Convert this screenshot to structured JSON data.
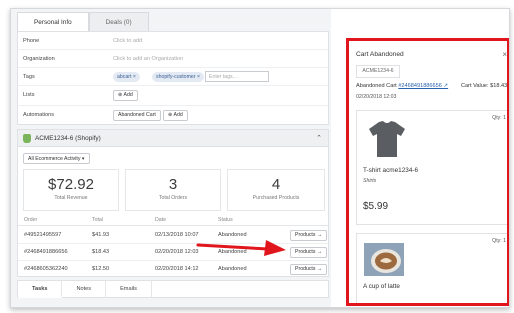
{
  "tabs": [
    {
      "label": "Personal Info",
      "active": true
    },
    {
      "label": "Deals (0)",
      "active": false
    }
  ],
  "info": {
    "phone": {
      "label": "Phone",
      "value": "Click to add"
    },
    "organization": {
      "label": "Organization",
      "value": "Click to add an Organization"
    },
    "tags": {
      "label": "Tags",
      "chips": [
        "abcart",
        "shopify-customer"
      ],
      "placeholder": "Enter tags..."
    },
    "lists": {
      "label": "Lists",
      "button": "Add"
    },
    "automations": {
      "label": "Automations",
      "chip": "Abandoned Cart",
      "button": "Add"
    }
  },
  "shop": {
    "title": "ACME1234-6 (Shopify)",
    "dropdown": "All Ecommerce Activity",
    "stats": [
      {
        "value": "$72.92",
        "label": "Total Revenue"
      },
      {
        "value": "3",
        "label": "Total Orders"
      },
      {
        "value": "4",
        "label": "Purchased Products"
      }
    ],
    "columns": [
      "Order",
      "Total",
      "Date",
      "Status"
    ],
    "rows": [
      {
        "order": "#49521495597",
        "total": "$41.93",
        "date": "02/13/2018 10:07",
        "status": "Abandoned",
        "button": "Products"
      },
      {
        "order": "#2468491886656",
        "total": "$18.43",
        "date": "02/20/2018 12:03",
        "status": "Abandoned",
        "button": "Products"
      },
      {
        "order": "#2468605362240",
        "total": "$12.50",
        "date": "02/20/2018 14:12",
        "status": "Abandoned",
        "button": "Products"
      }
    ]
  },
  "bottom_tabs": [
    "Tasks",
    "Notes",
    "Emails"
  ],
  "panel": {
    "title": "Cart Abandoned",
    "close": "×",
    "tab": "ACME1234-6",
    "cart_label": "Abandoned Cart",
    "cart_link": "#2468491886656 ↗",
    "value_label": "Cart Value: $18.43",
    "date": "02/20/2018 12:03",
    "items": [
      {
        "qty": "Qty: 1",
        "name": "T-shirt acme1234-6",
        "category": "Shirts",
        "price": "$5.99"
      },
      {
        "qty": "Qty: 1",
        "name": "A cup of latte",
        "category": "",
        "price": ""
      }
    ]
  },
  "colors": {
    "highlight": "#e0161c",
    "link": "#2a62b0",
    "shopify_green": "#7ab55c"
  }
}
